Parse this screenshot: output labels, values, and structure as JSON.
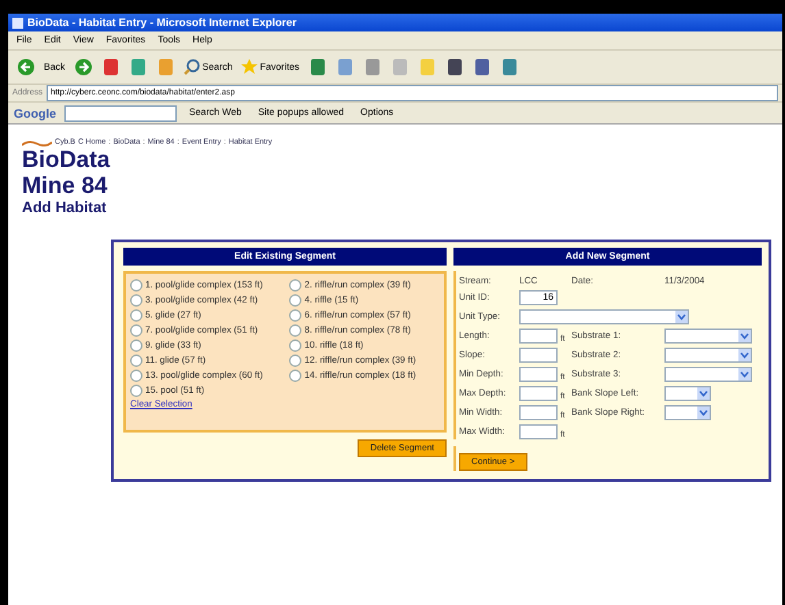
{
  "window": {
    "title": "BioData - Habitat Entry - Microsoft Internet Explorer"
  },
  "menu": [
    "File",
    "Edit",
    "View",
    "Favorites",
    "Tools",
    "Help"
  ],
  "toolbar": {
    "back": "Back",
    "search": "Search",
    "favorites": "Favorites"
  },
  "address": {
    "label": "Address",
    "url": "http://cyberc.ceonc.com/biodata/habitat/enter2.asp"
  },
  "google_bar": {
    "brand": "Google",
    "search": "Search Web",
    "popups": "Site popups allowed",
    "options": "Options"
  },
  "breadcrumb": {
    "separator": ":",
    "items": [
      "Cyb.B",
      "C Home",
      "BioData",
      "Mine 84",
      "Event Entry",
      "Habitat Entry"
    ]
  },
  "headings": [
    "BioData",
    "Mine 84",
    "Add Habitat"
  ],
  "edit_panel": {
    "title": "Edit Existing Segment",
    "segments": [
      {
        "label": "1. pool/glide complex (153 ft)",
        "selected": false
      },
      {
        "label": "2. riffle/run complex (39 ft)",
        "selected": false
      },
      {
        "label": "3. pool/glide complex (42 ft)",
        "selected": false
      },
      {
        "label": "4. riffle (15 ft)",
        "selected": false
      },
      {
        "label": "5. glide (27 ft)",
        "selected": false
      },
      {
        "label": "6. riffle/run complex (57 ft)",
        "selected": false
      },
      {
        "label": "7. pool/glide complex (51 ft)",
        "selected": false
      },
      {
        "label": "8. riffle/run complex (78 ft)",
        "selected": false
      },
      {
        "label": "9. glide (33 ft)",
        "selected": false
      },
      {
        "label": "10. riffle (18 ft)",
        "selected": false
      },
      {
        "label": "11. glide (57 ft)",
        "selected": false
      },
      {
        "label": "12. riffle/run complex (39 ft)",
        "selected": false
      },
      {
        "label": "13. pool/glide complex (60 ft)",
        "selected": false
      },
      {
        "label": "14. riffle/run complex (18 ft)",
        "selected": false
      },
      {
        "label": "15. pool (51 ft)",
        "selected": false
      }
    ],
    "clear": "Clear Selection",
    "delete": "Delete Segment"
  },
  "add_panel": {
    "title": "Add New Segment",
    "stream_label": "Stream:",
    "stream": "LCC",
    "date_label": "Date:",
    "date": "11/3/2004",
    "unit_id": {
      "label": "Unit ID:",
      "value": "16"
    },
    "unit_type": {
      "label": "Unit Type:"
    },
    "rows": [
      {
        "label": "Length:",
        "unit": "ft",
        "pair": {
          "label": "Substrate 1:",
          "kind": "wide"
        }
      },
      {
        "label": "Slope:",
        "pair": {
          "label": "Substrate 2:",
          "kind": "wide"
        }
      },
      {
        "label": "Min Depth:",
        "unit": "ft",
        "pair": {
          "label": "Substrate 3:",
          "kind": "wide"
        }
      },
      {
        "label": "Max Depth:",
        "unit": "ft",
        "pair": {
          "label": "Bank Slope Left:",
          "kind": "small"
        }
      },
      {
        "label": "Min Width:",
        "unit": "ft",
        "pair": {
          "label": "Bank Slope Right:",
          "kind": "small"
        }
      },
      {
        "label": "Max Width:",
        "unit": "ft"
      }
    ],
    "continue": "Continue >"
  }
}
